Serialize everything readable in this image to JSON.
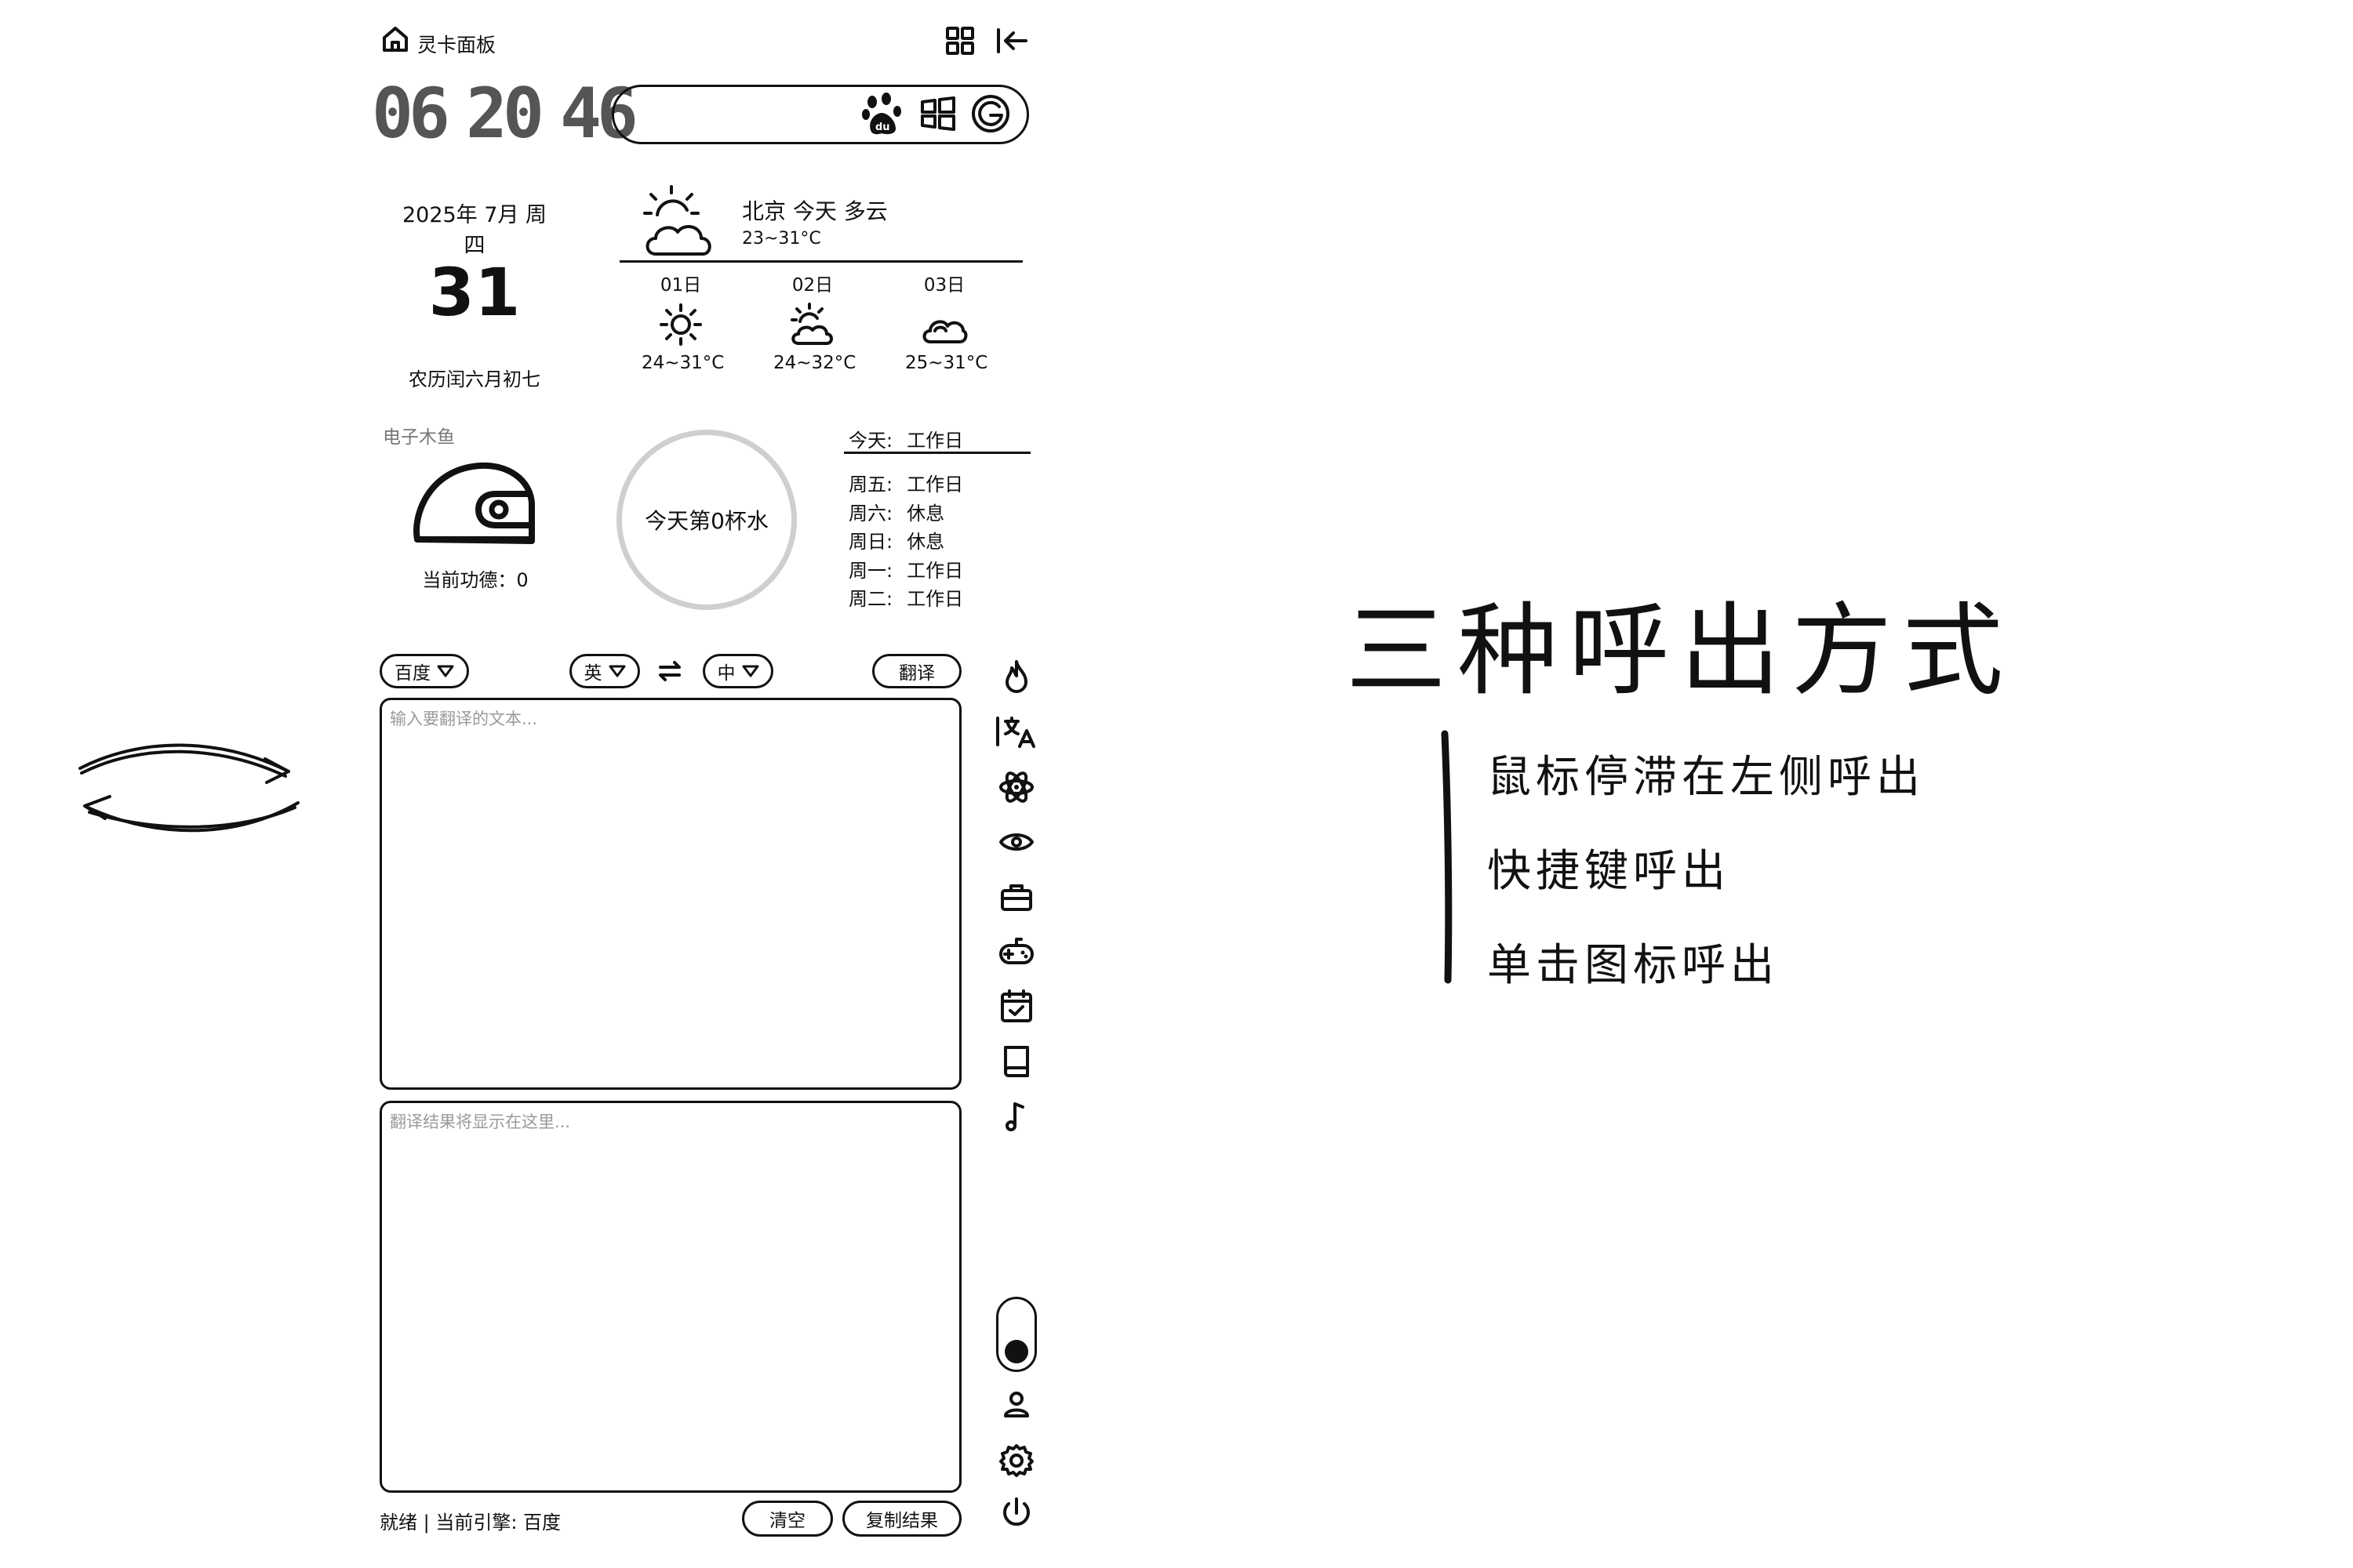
{
  "header": {
    "title": "灵卡面板"
  },
  "clock": {
    "digits": [
      "06",
      "20",
      "46"
    ]
  },
  "date": {
    "year_month_week": "2025年 7月 周四",
    "day": "31",
    "lunar": "农历闰六月初七"
  },
  "weather": {
    "current": {
      "summary": "北京 今天 多云",
      "range": "23~31°C",
      "icon": "partly-cloudy-icon"
    },
    "forecast": [
      {
        "day": "01日",
        "range": "24~31°C",
        "icon": "sun-icon"
      },
      {
        "day": "02日",
        "range": "24~32°C",
        "icon": "partly-cloudy-icon"
      },
      {
        "day": "03日",
        "range": "25~31°C",
        "icon": "cloud-icon"
      }
    ]
  },
  "muyu": {
    "title": "电子木鱼",
    "merit_label": "当前功德：0"
  },
  "water": {
    "label": "今天第0杯水"
  },
  "schedule": {
    "today": {
      "day": "今天:",
      "status": "工作日"
    },
    "rows": [
      {
        "day": "周五:",
        "status": "工作日"
      },
      {
        "day": "周六:",
        "status": "休息"
      },
      {
        "day": "周日:",
        "status": "休息"
      },
      {
        "day": "周一:",
        "status": "工作日"
      },
      {
        "day": "周二:",
        "status": "工作日"
      }
    ]
  },
  "translate": {
    "engine": "百度",
    "source_lang": "英",
    "target_lang": "中",
    "translate_button": "翻译",
    "input_placeholder": "输入要翻译的文本...",
    "output_placeholder": "翻译结果将显示在这里...",
    "status": "就绪 | 当前引擎: 百度",
    "clear_button": "清空",
    "copy_button": "复制结果"
  },
  "sidebar_icons": [
    "fire-icon",
    "translate-icon",
    "atom-icon",
    "eye-icon",
    "toolbox-icon",
    "gamepad-icon",
    "calendar-check-icon",
    "book-icon",
    "music-note-icon"
  ],
  "bottom_icons": [
    "user-icon",
    "gear-icon",
    "power-icon"
  ],
  "annotation": {
    "title": "三种呼出方式",
    "items": [
      "鼠标停滞在左侧呼出",
      "快捷键呼出",
      "单击图标呼出"
    ]
  }
}
